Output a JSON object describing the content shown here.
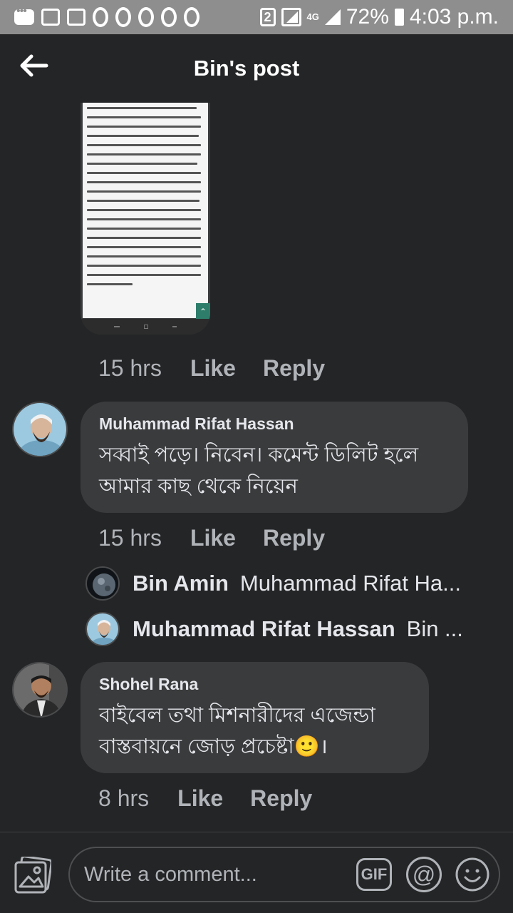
{
  "status_bar": {
    "sim_slot": "2",
    "network": "4G",
    "battery": "72%",
    "time": "4:03 p.m."
  },
  "header": {
    "title": "Bin's post"
  },
  "post_reply": {
    "meta": {
      "time": "15 hrs",
      "like_label": "Like",
      "reply_label": "Reply"
    }
  },
  "comments": [
    {
      "author": "Muhammad Rifat Hassan",
      "text": "সব্বাই পড়ে। নিবেন। কমেন্ট ডিলিট হলে আমার কাছ থেকে নিয়েন",
      "meta": {
        "time": "15 hrs",
        "like_label": "Like",
        "reply_label": "Reply"
      },
      "replies": [
        {
          "author": "Bin Amin",
          "snippet": "Muhammad Rifat Ha..."
        },
        {
          "author": "Muhammad Rifat Hassan",
          "snippet": "Bin ..."
        }
      ]
    },
    {
      "author": "Shohel Rana",
      "text": "বাইবেল তথা মিশনারীদের এজেন্ডা বাস্তবায়নে জোড় প্রচেষ্টা🙂।",
      "meta": {
        "time": "8 hrs",
        "like_label": "Like",
        "reply_label": "Reply"
      }
    }
  ],
  "composer": {
    "placeholder": "Write a comment...",
    "gif_label": "GIF",
    "mention_label": "@"
  },
  "colors": {
    "background": "#242526",
    "bubble": "#3a3b3c",
    "status_bar": "#8e8e8e",
    "muted_text": "#b0b3b8"
  }
}
